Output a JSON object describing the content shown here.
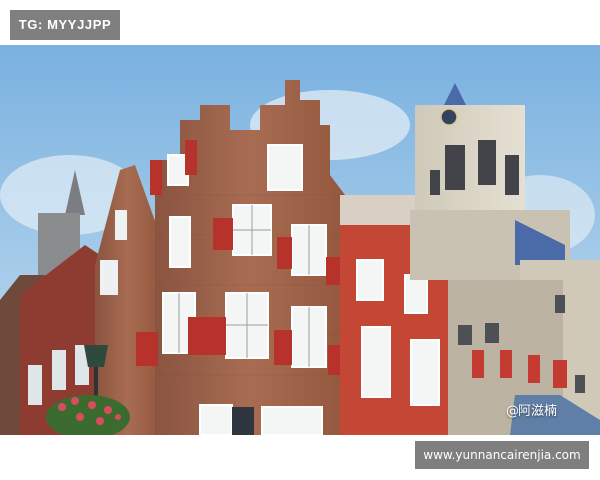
{
  "overlays": {
    "top_tag": "TG: MYYJJPP",
    "author_watermark": "阿滋楠",
    "author_at": "@",
    "site_url": "www.yunnancairenjia.com"
  },
  "photo": {
    "subject": "Delft street with stepped-gable brick houses and a clock tower",
    "colors": {
      "sky": "#8fc0e6",
      "brick": "#a0644a",
      "red_facade": "#c44634",
      "shutter": "#b8322c",
      "tower_stone": "#d8d2c4",
      "roof_blue": "#4a6aa8"
    }
  }
}
